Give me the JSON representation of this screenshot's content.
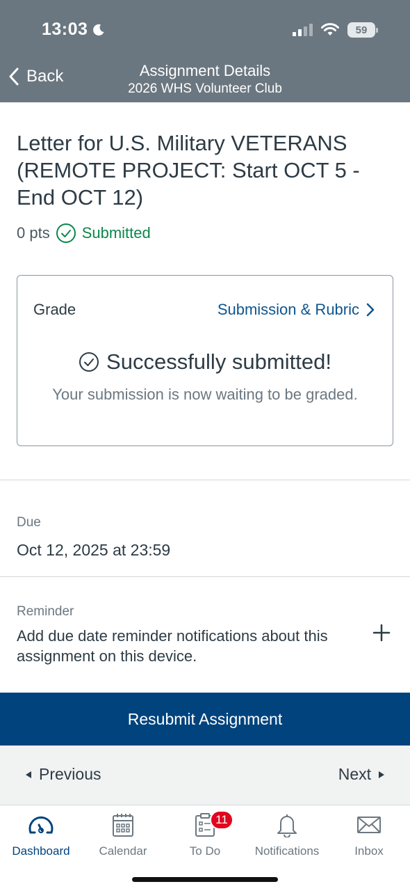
{
  "status_bar": {
    "time": "13:03",
    "battery": "59"
  },
  "nav": {
    "back_label": "Back",
    "title": "Assignment Details",
    "subtitle": "2026 WHS Volunteer Club"
  },
  "assignment": {
    "title": "Letter for U.S. Military VETERANS (REMOTE PROJECT: Start OCT 5 - End OCT 12)",
    "points": "0 pts",
    "status": "Submitted"
  },
  "grade_card": {
    "label": "Grade",
    "link": "Submission & Rubric",
    "success_title": "Successfully submitted!",
    "success_subtitle": "Your submission is now waiting to be graded."
  },
  "due": {
    "label": "Due",
    "value": "Oct 12, 2025 at 23:59"
  },
  "reminder": {
    "label": "Reminder",
    "text": "Add due date reminder notifications about this assignment on this device."
  },
  "actions": {
    "resubmit": "Resubmit Assignment",
    "previous": "Previous",
    "next": "Next"
  },
  "tabs": [
    {
      "label": "Dashboard",
      "icon": "dashboard-icon"
    },
    {
      "label": "Calendar",
      "icon": "calendar-icon"
    },
    {
      "label": "To Do",
      "icon": "todo-icon",
      "badge": "11"
    },
    {
      "label": "Notifications",
      "icon": "bell-icon"
    },
    {
      "label": "Inbox",
      "icon": "envelope-icon"
    }
  ],
  "colors": {
    "header": "#6b7780",
    "accent": "#00437d",
    "link": "#0e558f",
    "success": "#0b874b",
    "badge": "#e0061f"
  }
}
